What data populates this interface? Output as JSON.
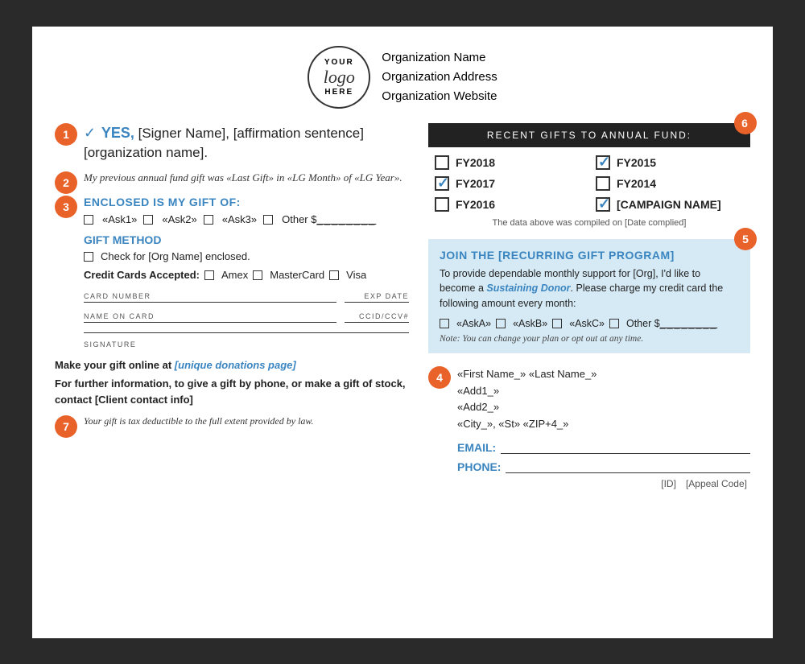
{
  "header": {
    "logo_your": "YOUR",
    "logo_logo": "logo",
    "logo_here": "HERE",
    "org_name": "Organization Name",
    "org_address": "Organization Address",
    "org_website": "Organization Website"
  },
  "section1": {
    "badge": "1",
    "check": "✓",
    "yes": "YES,",
    "text": " [Signer Name], [affirmation sentence] [organization name]."
  },
  "section2": {
    "badge": "2",
    "text": "My previous annual fund gift was «Last Gift» in «LG Month» of «LG Year»."
  },
  "section3": {
    "badge": "3",
    "title": "ENCLOSED IS MY GIFT OF:",
    "ask1": "«Ask1»",
    "ask2": "«Ask2»",
    "ask3": "«Ask3»",
    "other_label": "Other $",
    "other_line": "________",
    "gift_method_title": "GIFT METHOD",
    "check_line": "Check for [Org Name] enclosed.",
    "credit_cards_label": "Credit Cards Accepted:",
    "amex": "Amex",
    "mastercard": "MasterCard",
    "visa": "Visa",
    "card_number_label": "CARD NUMBER",
    "exp_date_label": "EXP DATE",
    "name_on_card_label": "NAME ON CARD",
    "ccid_label": "CCID/CCV#",
    "signature_label": "SIGNATURE"
  },
  "online_gift": {
    "text": "Make your gift online at ",
    "link": "[unique donations page]"
  },
  "phone_info": {
    "text": "For further information, to give a gift by phone, or make a gift of stock, contact [Client contact info]"
  },
  "section7": {
    "badge": "7",
    "text": "Your gift is tax deductible to the full extent provided by law."
  },
  "section6": {
    "badge": "6",
    "title": "RECENT GIFTS TO ANNUAL FUND:",
    "gifts": [
      {
        "label": "FY2018",
        "checked": false
      },
      {
        "label": "FY2015",
        "checked": true
      },
      {
        "label": "FY2017",
        "checked": true
      },
      {
        "label": "FY2014",
        "checked": false
      },
      {
        "label": "FY2016",
        "checked": false
      },
      {
        "label": "[CAMPAIGN NAME]",
        "checked": true
      }
    ],
    "compiled_note": "The data above was compiled on [Date complied]"
  },
  "section5": {
    "badge": "5",
    "title": "JOIN THE [RECURRING GIFT PROGRAM]",
    "body_start": "To provide dependable monthly support for [Org], I'd like to become a ",
    "sustaining_link": "Sustaining Donor",
    "body_end": ". Please charge my credit card the following amount every month:",
    "askA": "«AskA»",
    "askB": "«AskB»",
    "askC": "«AskC»",
    "other_label": "Other $",
    "other_line": "________",
    "note": "Note: You can change your plan or opt out at any time."
  },
  "section4": {
    "badge": "4",
    "first_last": "«First Name_» «Last Name_»",
    "add1": "«Add1_»",
    "add2": "«Add2_»",
    "city_st_zip": "«City_», «St» «ZIP+4_»",
    "email_label": "EMAIL:",
    "phone_label": "PHONE:"
  },
  "footer": {
    "id": "[ID]",
    "appeal_code": "[Appeal Code]"
  }
}
